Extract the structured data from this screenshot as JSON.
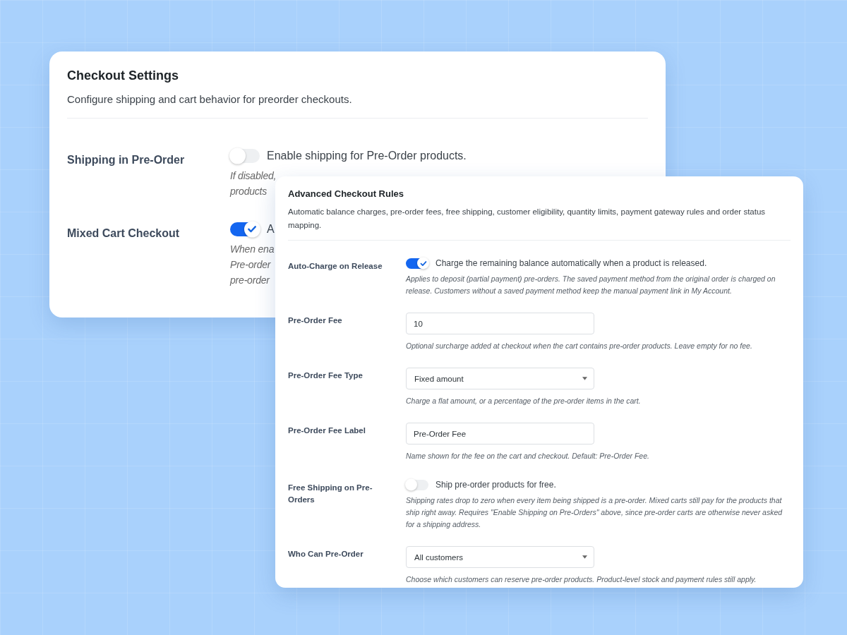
{
  "checkout_settings": {
    "title": "Checkout Settings",
    "description": "Configure shipping and cart behavior for preorder checkouts.",
    "rows": [
      {
        "label": "Shipping in Pre-Order",
        "on": false,
        "toggle_label": "Enable shipping for Pre-Order products.",
        "hint_lines": [
          "If disabled,",
          "products"
        ]
      },
      {
        "label": "Mixed Cart Checkout",
        "on": true,
        "toggle_label": "A",
        "hint_lines": [
          "When ena",
          "Pre-order",
          "pre-order"
        ]
      }
    ]
  },
  "advanced_rules": {
    "title": "Advanced Checkout Rules",
    "description": "Automatic balance charges, pre-order fees, free shipping, customer eligibility, quantity limits, payment gateway rules and order status mapping.",
    "rows": [
      {
        "label": "Auto-Charge on Release",
        "kind": "toggle",
        "on": true,
        "toggle_label": "Charge the remaining balance automatically when a product is released.",
        "hint": "Applies to deposit (partial payment) pre-orders. The saved payment method from the original order is charged on release. Customers without a saved payment method keep the manual payment link in My Account."
      },
      {
        "label": "Pre-Order Fee",
        "kind": "text",
        "value": "10",
        "hint": "Optional surcharge added at checkout when the cart contains pre-order products. Leave empty for no fee."
      },
      {
        "label": "Pre-Order Fee Type",
        "kind": "select",
        "value": "Fixed amount",
        "hint": "Charge a flat amount, or a percentage of the pre-order items in the cart."
      },
      {
        "label": "Pre-Order Fee Label",
        "kind": "text",
        "value": "Pre-Order Fee",
        "hint": "Name shown for the fee on the cart and checkout. Default: Pre-Order Fee."
      },
      {
        "label": "Free Shipping on Pre-Orders",
        "kind": "toggle",
        "on": false,
        "toggle_label": "Ship pre-order products for free.",
        "hint": "Shipping rates drop to zero when every item being shipped is a pre-order. Mixed carts still pay for the products that ship right away. Requires \"Enable Shipping on Pre-Orders\" above, since pre-order carts are otherwise never asked for a shipping address."
      },
      {
        "label": "Who Can Pre-Order",
        "kind": "select",
        "value": "All customers",
        "hint": "Choose which customers can reserve pre-order products. Product-level stock and payment rules still apply."
      }
    ]
  }
}
